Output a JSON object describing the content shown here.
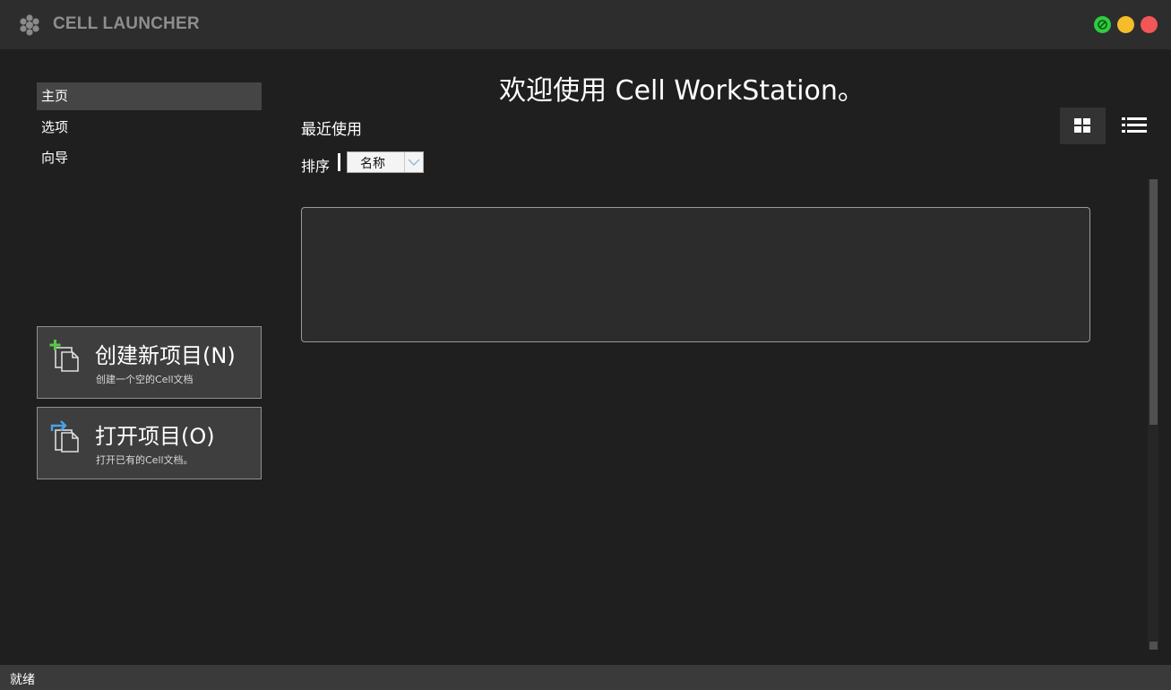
{
  "window": {
    "title": "CELL LAUNCHER"
  },
  "nav": {
    "items": [
      {
        "label": "主页",
        "active": true
      },
      {
        "label": "选项",
        "active": false
      },
      {
        "label": "向导",
        "active": false
      }
    ]
  },
  "actions": {
    "new_project": {
      "title": "创建新项目(N)",
      "subtitle": "创建一个空的Cell文档",
      "icon": "new-document-icon"
    },
    "open_project": {
      "title": "打开项目(O)",
      "subtitle": "打开已有的Cell文档。",
      "icon": "open-document-icon"
    }
  },
  "main": {
    "welcome": "欢迎使用 Cell WorkStation。",
    "recent_title": "最近使用",
    "sort_label": "排序",
    "sort_value": "名称",
    "view_modes": [
      "grid-view-icon",
      "list-view-icon"
    ],
    "active_view": "grid"
  },
  "status": {
    "text": "就绪"
  },
  "colors": {
    "titlebar": "#2d2d2d",
    "background": "#1f1f1f",
    "accent_green": "#2ecc40",
    "accent_yellow": "#f5bd2a",
    "accent_red": "#f25656"
  }
}
